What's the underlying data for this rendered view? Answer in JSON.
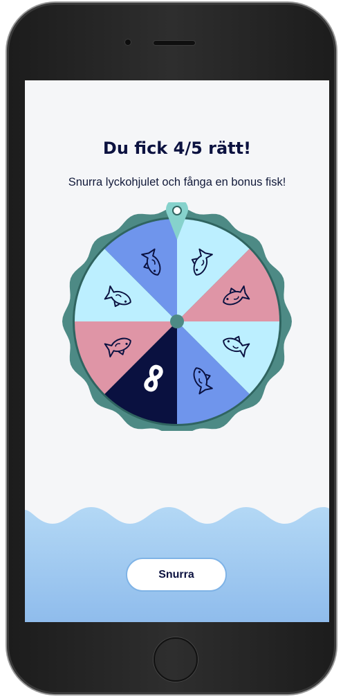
{
  "screen": {
    "title": "Du fick 4/5 rätt!",
    "subtitle": "Snurra lyckohjulet och fånga en bonus fisk!",
    "spin_button_label": "Snurra"
  },
  "wheel": {
    "segments": [
      {
        "color": "#bcefff",
        "icon": "fish-icon"
      },
      {
        "color": "#df95a6",
        "icon": "fish-icon"
      },
      {
        "color": "#bcefff",
        "icon": "fish-icon"
      },
      {
        "color": "#6f95ec",
        "icon": "fish-icon"
      },
      {
        "color": "#0a1140",
        "icon": "infinity-icon"
      },
      {
        "color": "#df95a6",
        "icon": "fish-icon"
      },
      {
        "color": "#bcefff",
        "icon": "fish-icon"
      },
      {
        "color": "#6f95ec",
        "icon": "fish-icon"
      }
    ],
    "rim_color": "#4d8a85",
    "pointer_color": "#86d2cc"
  },
  "colors": {
    "title": "#0c1240",
    "water": "#9cc8ef",
    "button_border": "#7fb3e6"
  }
}
